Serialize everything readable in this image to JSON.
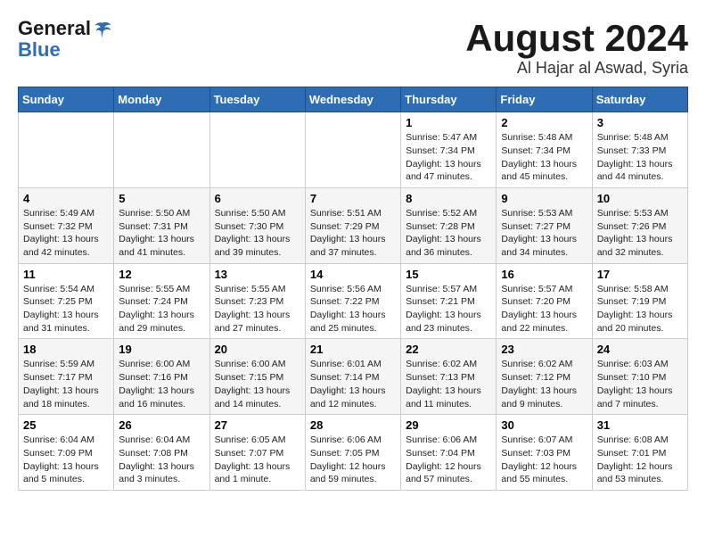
{
  "logo": {
    "line1": "General",
    "line2": "Blue"
  },
  "title": "August 2024",
  "subtitle": "Al Hajar al Aswad, Syria",
  "weekdays": [
    "Sunday",
    "Monday",
    "Tuesday",
    "Wednesday",
    "Thursday",
    "Friday",
    "Saturday"
  ],
  "weeks": [
    [
      {
        "day": "",
        "info": ""
      },
      {
        "day": "",
        "info": ""
      },
      {
        "day": "",
        "info": ""
      },
      {
        "day": "",
        "info": ""
      },
      {
        "day": "1",
        "info": "Sunrise: 5:47 AM\nSunset: 7:34 PM\nDaylight: 13 hours and 47 minutes."
      },
      {
        "day": "2",
        "info": "Sunrise: 5:48 AM\nSunset: 7:34 PM\nDaylight: 13 hours and 45 minutes."
      },
      {
        "day": "3",
        "info": "Sunrise: 5:48 AM\nSunset: 7:33 PM\nDaylight: 13 hours and 44 minutes."
      }
    ],
    [
      {
        "day": "4",
        "info": "Sunrise: 5:49 AM\nSunset: 7:32 PM\nDaylight: 13 hours and 42 minutes."
      },
      {
        "day": "5",
        "info": "Sunrise: 5:50 AM\nSunset: 7:31 PM\nDaylight: 13 hours and 41 minutes."
      },
      {
        "day": "6",
        "info": "Sunrise: 5:50 AM\nSunset: 7:30 PM\nDaylight: 13 hours and 39 minutes."
      },
      {
        "day": "7",
        "info": "Sunrise: 5:51 AM\nSunset: 7:29 PM\nDaylight: 13 hours and 37 minutes."
      },
      {
        "day": "8",
        "info": "Sunrise: 5:52 AM\nSunset: 7:28 PM\nDaylight: 13 hours and 36 minutes."
      },
      {
        "day": "9",
        "info": "Sunrise: 5:53 AM\nSunset: 7:27 PM\nDaylight: 13 hours and 34 minutes."
      },
      {
        "day": "10",
        "info": "Sunrise: 5:53 AM\nSunset: 7:26 PM\nDaylight: 13 hours and 32 minutes."
      }
    ],
    [
      {
        "day": "11",
        "info": "Sunrise: 5:54 AM\nSunset: 7:25 PM\nDaylight: 13 hours and 31 minutes."
      },
      {
        "day": "12",
        "info": "Sunrise: 5:55 AM\nSunset: 7:24 PM\nDaylight: 13 hours and 29 minutes."
      },
      {
        "day": "13",
        "info": "Sunrise: 5:55 AM\nSunset: 7:23 PM\nDaylight: 13 hours and 27 minutes."
      },
      {
        "day": "14",
        "info": "Sunrise: 5:56 AM\nSunset: 7:22 PM\nDaylight: 13 hours and 25 minutes."
      },
      {
        "day": "15",
        "info": "Sunrise: 5:57 AM\nSunset: 7:21 PM\nDaylight: 13 hours and 23 minutes."
      },
      {
        "day": "16",
        "info": "Sunrise: 5:57 AM\nSunset: 7:20 PM\nDaylight: 13 hours and 22 minutes."
      },
      {
        "day": "17",
        "info": "Sunrise: 5:58 AM\nSunset: 7:19 PM\nDaylight: 13 hours and 20 minutes."
      }
    ],
    [
      {
        "day": "18",
        "info": "Sunrise: 5:59 AM\nSunset: 7:17 PM\nDaylight: 13 hours and 18 minutes."
      },
      {
        "day": "19",
        "info": "Sunrise: 6:00 AM\nSunset: 7:16 PM\nDaylight: 13 hours and 16 minutes."
      },
      {
        "day": "20",
        "info": "Sunrise: 6:00 AM\nSunset: 7:15 PM\nDaylight: 13 hours and 14 minutes."
      },
      {
        "day": "21",
        "info": "Sunrise: 6:01 AM\nSunset: 7:14 PM\nDaylight: 13 hours and 12 minutes."
      },
      {
        "day": "22",
        "info": "Sunrise: 6:02 AM\nSunset: 7:13 PM\nDaylight: 13 hours and 11 minutes."
      },
      {
        "day": "23",
        "info": "Sunrise: 6:02 AM\nSunset: 7:12 PM\nDaylight: 13 hours and 9 minutes."
      },
      {
        "day": "24",
        "info": "Sunrise: 6:03 AM\nSunset: 7:10 PM\nDaylight: 13 hours and 7 minutes."
      }
    ],
    [
      {
        "day": "25",
        "info": "Sunrise: 6:04 AM\nSunset: 7:09 PM\nDaylight: 13 hours and 5 minutes."
      },
      {
        "day": "26",
        "info": "Sunrise: 6:04 AM\nSunset: 7:08 PM\nDaylight: 13 hours and 3 minutes."
      },
      {
        "day": "27",
        "info": "Sunrise: 6:05 AM\nSunset: 7:07 PM\nDaylight: 13 hours and 1 minute."
      },
      {
        "day": "28",
        "info": "Sunrise: 6:06 AM\nSunset: 7:05 PM\nDaylight: 12 hours and 59 minutes."
      },
      {
        "day": "29",
        "info": "Sunrise: 6:06 AM\nSunset: 7:04 PM\nDaylight: 12 hours and 57 minutes."
      },
      {
        "day": "30",
        "info": "Sunrise: 6:07 AM\nSunset: 7:03 PM\nDaylight: 12 hours and 55 minutes."
      },
      {
        "day": "31",
        "info": "Sunrise: 6:08 AM\nSunset: 7:01 PM\nDaylight: 12 hours and 53 minutes."
      }
    ]
  ]
}
